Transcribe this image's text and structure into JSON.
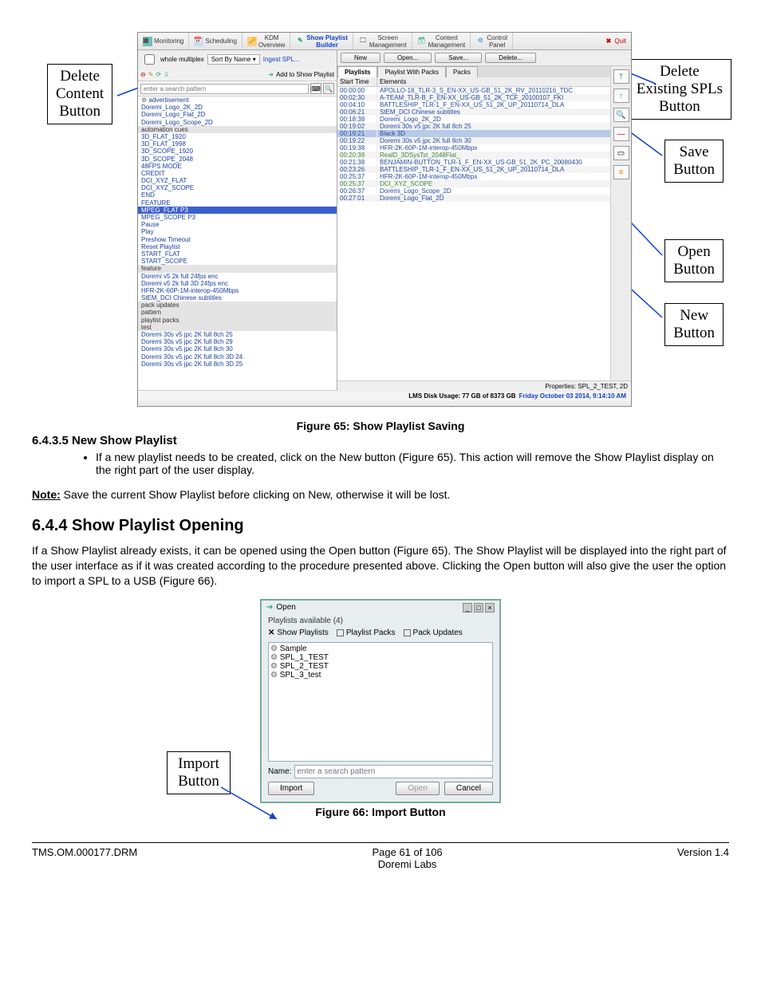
{
  "figure65_caption": "Figure 65: Show Playlist Saving",
  "figure66_caption": "Figure 66: Import Button",
  "callouts": {
    "deleteContent": "Delete\nContent\nButton",
    "deleteSpl": "Delete\nExisting SPLs\nButton",
    "saveBtn": "Save\nButton",
    "openBtn": "Open\nButton",
    "newBtn": "New\nButton",
    "importBtn": "Import\nButton"
  },
  "menubar": {
    "monitoring": "Monitoring",
    "scheduling": "Scheduling",
    "kdm": "KDM\nOverview",
    "builder": "Show Playlist\nBuilder",
    "screen": "Screen\nManagement",
    "content": "Content\nManagement",
    "control": "Control\nPanel",
    "quit": "Quit"
  },
  "filter": {
    "whole": "whole multiplex",
    "sort": "Sort By Name",
    "ingest": "Ingest SPL...",
    "addShow": "Add to Show Playlist",
    "searchPlaceholder": "enter a search pattern"
  },
  "actions": {
    "new": "New",
    "open": "Open...",
    "save": "Save...",
    "delete": "Delete..."
  },
  "subtabs": {
    "playlists": "Playlists",
    "withPacks": "Playlist With Packs",
    "packs": "Packs"
  },
  "tableHdr": {
    "time": "Start Time",
    "elem": "Elements"
  },
  "leftList": [
    {
      "t": "adv",
      "v": "advertisement"
    },
    {
      "v": "Doremi_Logo_2K_2D"
    },
    {
      "v": "Doremi_Logo_Flat_2D"
    },
    {
      "v": "Doremi_Logo_Scope_2D"
    },
    {
      "t": "cat",
      "v": "automation cues"
    },
    {
      "v": "3D_FLAT_1920"
    },
    {
      "v": "3D_FLAT_1998"
    },
    {
      "v": "3D_SCOPE_1920"
    },
    {
      "v": "3D_SCOPE_2048"
    },
    {
      "v": "48FPS MODE"
    },
    {
      "v": "CREDIT"
    },
    {
      "v": "DCI_XYZ_FLAT"
    },
    {
      "v": "DCI_XYZ_SCOPE"
    },
    {
      "v": "END"
    },
    {
      "v": "FEATURE"
    },
    {
      "t": "hilite",
      "v": "MPEG_FLAT P3"
    },
    {
      "v": "MPEG_SCOPE P3"
    },
    {
      "v": "Pause"
    },
    {
      "v": "Play"
    },
    {
      "v": "Preshow Timeout"
    },
    {
      "v": "Reset Playlist"
    },
    {
      "v": "START_FLAT"
    },
    {
      "v": "START_SCOPE"
    },
    {
      "t": "cat",
      "v": "feature"
    },
    {
      "v": "Doremi v5 2k full 24fps enc"
    },
    {
      "v": "Doremi v5 2k full 3D 24fps enc"
    },
    {
      "v": "HFR-2K-60P-1M-interop-450Mbps"
    },
    {
      "v": "StEM_DCI Chinese subtitles"
    },
    {
      "t": "cat",
      "v": "pack updates"
    },
    {
      "t": "cat",
      "v": "pattern"
    },
    {
      "t": "cat",
      "v": "playlist packs"
    },
    {
      "t": "cat",
      "v": "test"
    },
    {
      "v": "Doremi 30s v5 jpc 2K full 8ch 25"
    },
    {
      "v": "Doremi 30s v5 jpc 2K full 8ch 29"
    },
    {
      "v": "Doremi 30s v5 jpc 2K full 8ch 30"
    },
    {
      "v": "Doremi 30s v5 jpc 2K full 8ch 3D 24"
    },
    {
      "v": "Doremi 30s v5 jpc 2K full 8ch 3D 25"
    }
  ],
  "plRows": [
    {
      "t": "00:00:00",
      "e": "APOLLO-18_TLR-3_S_EN-XX_US-GB_51_2K_RV_20110216_TDC"
    },
    {
      "t": "00:02:30",
      "e": "A-TEAM_TLR-B_F_EN-XX_US-GB_51_2K_TCF_20100107_FKI"
    },
    {
      "t": "00:04:10",
      "e": "BATTLESHIP_TLR-1_F_EN-XX_US_51_2K_UP_20110714_DLA"
    },
    {
      "t": "00:06:21",
      "e": "StEM_DCI Chinese subtitles"
    },
    {
      "t": "00:18:38",
      "e": "Doremi_Logo_2K_2D"
    },
    {
      "t": "00:19:02",
      "e": "Doremi 30s v5 jpc 2K full 8ch 25"
    },
    {
      "t": "00:19:21",
      "e": "Black 3D",
      "c": "sel"
    },
    {
      "t": "00:19:22",
      "e": "Doremi 30s v5 jpc 2K full 8ch 30"
    },
    {
      "t": "00:19:38",
      "e": "HFR-2K-60P-1M-interop-450Mbps"
    },
    {
      "t": "00:20:38",
      "e": "RealD_3DSysTst_2048Flat_",
      "c": "green"
    },
    {
      "t": "00:21:38",
      "e": "BENJAMIN-BUTTON_TLR-1_F_EN-XX_US-GB_51_2K_PC_20080430"
    },
    {
      "t": "00:23:26",
      "e": "BATTLESHIP_TLR-1_F_EN-XX_US_51_2K_UP_20110714_DLA"
    },
    {
      "t": "00:25:37",
      "e": "HFR-2K-60P-1M-interop-450Mbps"
    },
    {
      "t": "00:25:37",
      "e": "DCI_XYZ_SCOPE",
      "c": "green"
    },
    {
      "t": "00:26:37",
      "e": "Doremi_Logo_Scope_2D"
    },
    {
      "t": "00:27:01",
      "e": "Doremi_Logo_Flat_2D"
    }
  ],
  "props": "Properties: SPL_2_TEST, 2D",
  "status": {
    "a": "LMS Disk Usage: 77 GB of 8373 GB",
    "b": "Friday October 03 2014, 9:14:10 AM"
  },
  "doc": {
    "s6435_h": "6.4.3.5 New Show Playlist",
    "s6435_b1": "If a new playlist needs to be created, click on the New button  (Figure 65). This action will remove the Show Playlist display on the right part of the user display.",
    "note_label": "Note:",
    "note_body": " Save the current Show Playlist before clicking on New, otherwise it will be lost.",
    "s644_h": "6.4.4  Show Playlist Opening",
    "s644_p": "If a Show Playlist already exists, it can be opened using the Open button (Figure 65). The Show Playlist will be displayed into the right part of the user interface as if it was created according to the procedure presented above. Clicking the Open button will also give the user the option to import a SPL to a USB (Figure 66)."
  },
  "openDlg": {
    "title": "Open",
    "avail": "Playlists available   (4)",
    "chips": {
      "show": "Show Playlists",
      "packs": "Playlist Packs",
      "upd": "Pack Updates"
    },
    "items": [
      "Sample",
      "SPL_1_TEST",
      "SPL_2_TEST",
      "SPL_3_test"
    ],
    "nameLbl": "Name:",
    "namePh": "enter a search pattern",
    "import": "Import",
    "open": "Open",
    "cancel": "Cancel"
  },
  "footer": {
    "left": "TMS.OM.000177.DRM",
    "mid1": "Page 61 of 106",
    "mid2": "Doremi Labs",
    "right": "Version 1.4"
  }
}
